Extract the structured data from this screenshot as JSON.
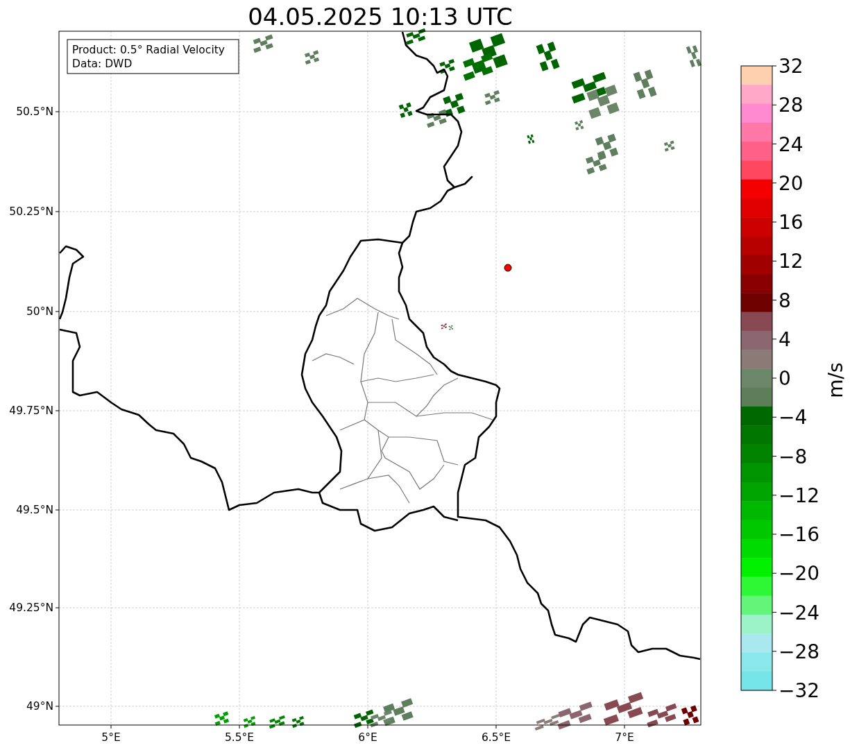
{
  "title": "04.05.2025 10:13 UTC",
  "legend": [
    "Product: 0.5° Radial Velocity",
    "Data: DWD"
  ],
  "x_axis": {
    "ticks": [
      "5°E",
      "5.5°E",
      "6°E",
      "6.5°E",
      "7°E"
    ]
  },
  "y_axis": {
    "ticks": [
      "50.5°N",
      "50.25°N",
      "50°N",
      "49.75°N",
      "49.5°N",
      "49.25°N",
      "49°N"
    ]
  },
  "colorbar": {
    "label": "m/s",
    "ticks": [
      "32",
      "28",
      "24",
      "20",
      "16",
      "12",
      "8",
      "4",
      "0",
      "−4",
      "−8",
      "−12",
      "−16",
      "−20",
      "−24",
      "−28",
      "−32"
    ],
    "bands": [
      {
        "color": "#ffd0b0"
      },
      {
        "color": "#ffa8c8"
      },
      {
        "color": "#ff8ad0"
      },
      {
        "color": "#ff78a8"
      },
      {
        "color": "#ff6088"
      },
      {
        "color": "#ff4860"
      },
      {
        "color": "#f40000"
      },
      {
        "color": "#e00000"
      },
      {
        "color": "#cc0000"
      },
      {
        "color": "#b80000"
      },
      {
        "color": "#a00000"
      },
      {
        "color": "#880000"
      },
      {
        "color": "#6e0000"
      },
      {
        "color": "#884a52"
      },
      {
        "color": "#8a6670"
      },
      {
        "color": "#8b7a76"
      },
      {
        "color": "#6b8668"
      },
      {
        "color": "#5e7e5a"
      },
      {
        "color": "#006800"
      },
      {
        "color": "#007500"
      },
      {
        "color": "#008400"
      },
      {
        "color": "#009400"
      },
      {
        "color": "#00a400"
      },
      {
        "color": "#00b800"
      },
      {
        "color": "#00c800"
      },
      {
        "color": "#00dc00"
      },
      {
        "color": "#00f000"
      },
      {
        "color": "#2ef835"
      },
      {
        "color": "#63f47a"
      },
      {
        "color": "#9df3c8"
      },
      {
        "color": "#a9e8ee"
      },
      {
        "color": "#8ae7ea"
      },
      {
        "color": "#74e4e8"
      }
    ]
  }
}
